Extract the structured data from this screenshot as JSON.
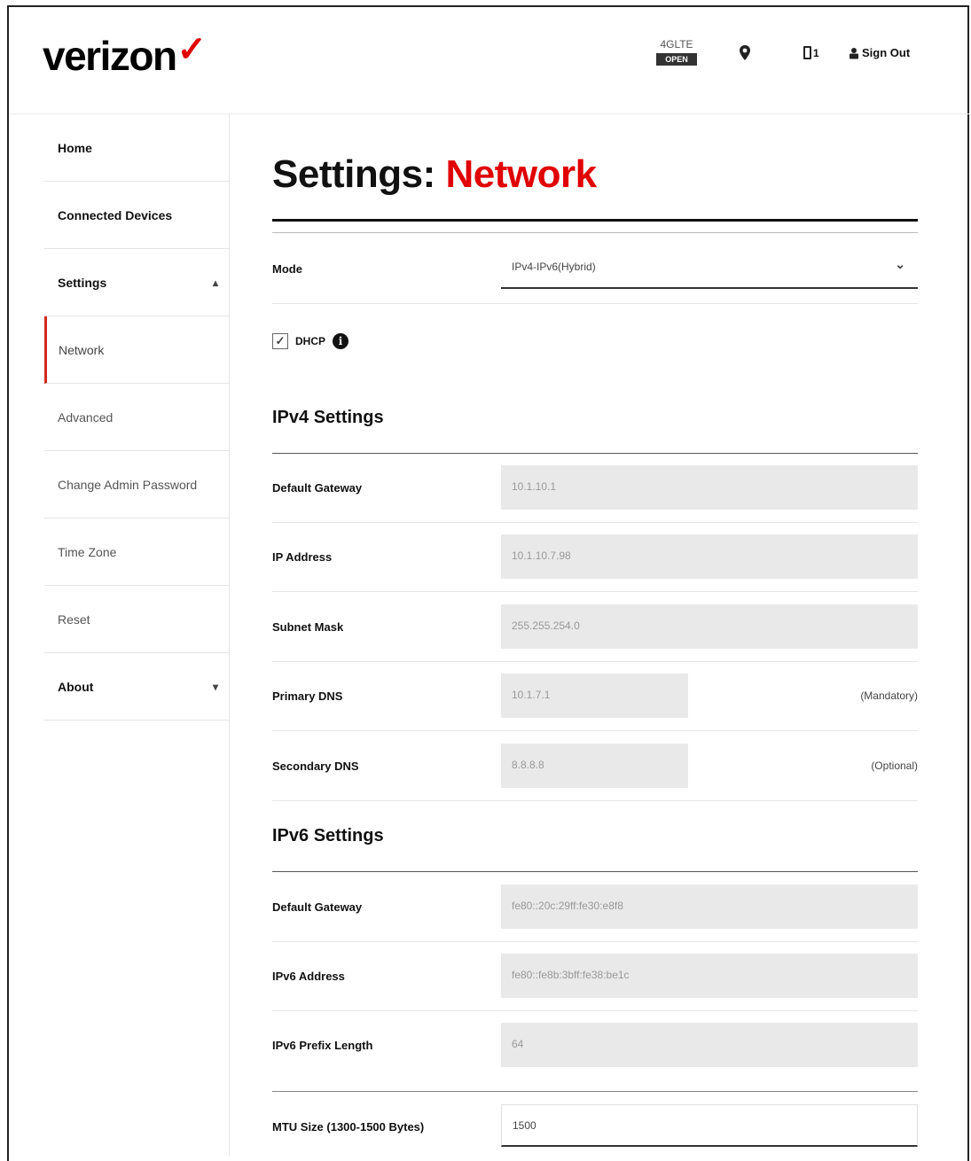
{
  "brand": {
    "logo_text": "verizon",
    "accent_color": "#e00000"
  },
  "header": {
    "network_type": "4GLTE",
    "network_badge": "OPEN",
    "location_icon": "location-pin-icon",
    "device_count": "1",
    "signout_label": "Sign Out"
  },
  "sidebar": {
    "items": [
      {
        "label": "Home"
      },
      {
        "label": "Connected Devices"
      },
      {
        "label": "Settings",
        "chevron": "⌃"
      },
      {
        "label": "Network"
      },
      {
        "label": "Advanced"
      },
      {
        "label": "Change Admin Password"
      },
      {
        "label": "Time Zone"
      },
      {
        "label": "Reset"
      },
      {
        "label": "About",
        "chevron": "⌄"
      }
    ]
  },
  "page": {
    "title_prefix": "Settings:",
    "title_highlight": "Network"
  },
  "mode": {
    "label": "Mode",
    "value": "IPv4-IPv6(Hybrid)"
  },
  "dhcp": {
    "label": "DHCP",
    "checked": true
  },
  "ipv4": {
    "title": "IPv4 Settings",
    "default_gateway_label": "Default Gateway",
    "default_gateway": "10.1.10.1",
    "ip_address_label": "IP Address",
    "ip_address": "10.1.10.7.98",
    "subnet_mask_label": "Subnet Mask",
    "subnet_mask": "255.255.254.0",
    "primary_dns_label": "Primary DNS",
    "primary_dns": "10.1.7.1",
    "primary_dns_hint": "(Mandatory)",
    "secondary_dns_label": "Secondary DNS",
    "secondary_dns": "8.8.8.8",
    "secondary_dns_hint": "(Optional)"
  },
  "ipv6": {
    "title": "IPv6 Settings",
    "default_gateway_label": "Default Gateway",
    "default_gateway": "fe80::20c:29ff:fe30:e8f8",
    "address_label": "IPv6 Address",
    "address": "fe80::fe8b:3bff:fe38:be1c",
    "prefix_label": "IPv6 Prefix Length",
    "prefix": "64"
  },
  "mtu": {
    "label": "MTU Size (1300-1500 Bytes)",
    "value": "1500"
  }
}
